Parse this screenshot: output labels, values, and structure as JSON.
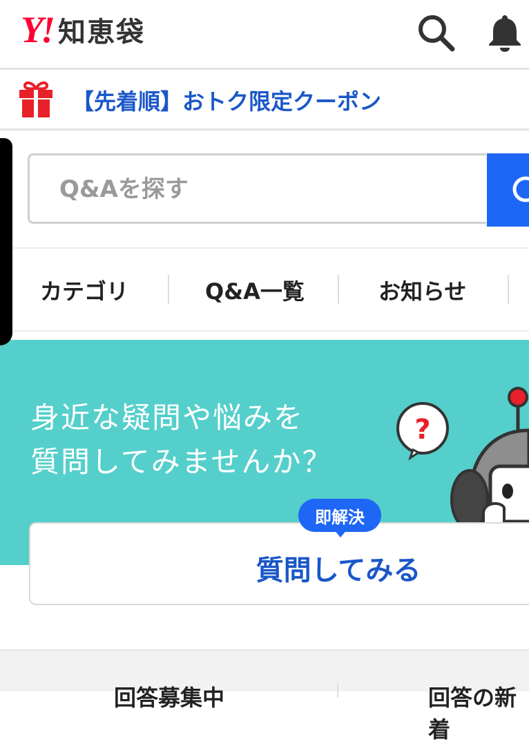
{
  "header": {
    "logo_mark": "Y!",
    "logo_text": "知恵袋",
    "icons": [
      "search-icon",
      "bell-icon"
    ]
  },
  "coupon": {
    "icon": "gift-icon",
    "text": "【先着順】おトク限定クーポン"
  },
  "search": {
    "placeholder": "Q&Aを探す",
    "value": ""
  },
  "tabs": [
    {
      "label": "カテゴリ"
    },
    {
      "label": "Q&A一覧"
    },
    {
      "label": "お知らせ"
    }
  ],
  "hero": {
    "line1": "身近な疑問や悩みを",
    "line2": "質問してみませんか？",
    "badge": "即解決",
    "ask_button": "質問してみる",
    "question_mark": "?"
  },
  "bottom": {
    "left": "回答募集中",
    "right": "回答の新着"
  },
  "colors": {
    "brand_red": "#ff0033",
    "link_blue": "#1a57c8",
    "accent_blue": "#1e66f5",
    "hero_teal": "#55cfcb"
  }
}
